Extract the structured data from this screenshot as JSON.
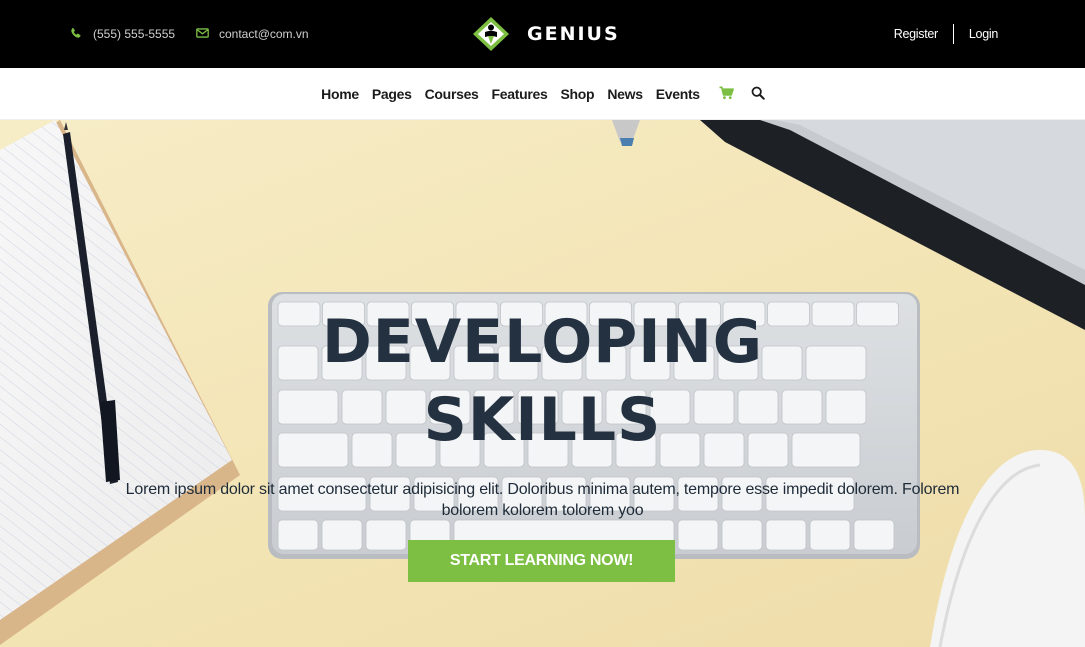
{
  "topbar": {
    "phone": "(555) 555-5555",
    "phone_icon": "phone-icon",
    "email": "contact@com.vn",
    "email_icon": "envelope-icon",
    "brand": "GENIUS",
    "register": "Register",
    "login": "Login"
  },
  "nav": {
    "items": [
      {
        "label": "Home"
      },
      {
        "label": "Pages"
      },
      {
        "label": "Courses"
      },
      {
        "label": "Features"
      },
      {
        "label": "Shop"
      },
      {
        "label": "News"
      },
      {
        "label": "Events"
      }
    ],
    "cart_icon": "cart-icon",
    "search_icon": "search-icon"
  },
  "hero": {
    "title_line1": "DEVELOPING",
    "title_line2": "SKILLS",
    "text": "Lorem ipsum dolor sit amet consectetur adipisicing elit. Doloribus minima autem, tempore esse impedit dolorem. Folorem bolorem kolorem tolorem yoo",
    "cta": "START LEARNING NOW!"
  },
  "colors": {
    "accent": "#7cbf42",
    "topbar_bg": "#000000",
    "title": "#243140"
  }
}
